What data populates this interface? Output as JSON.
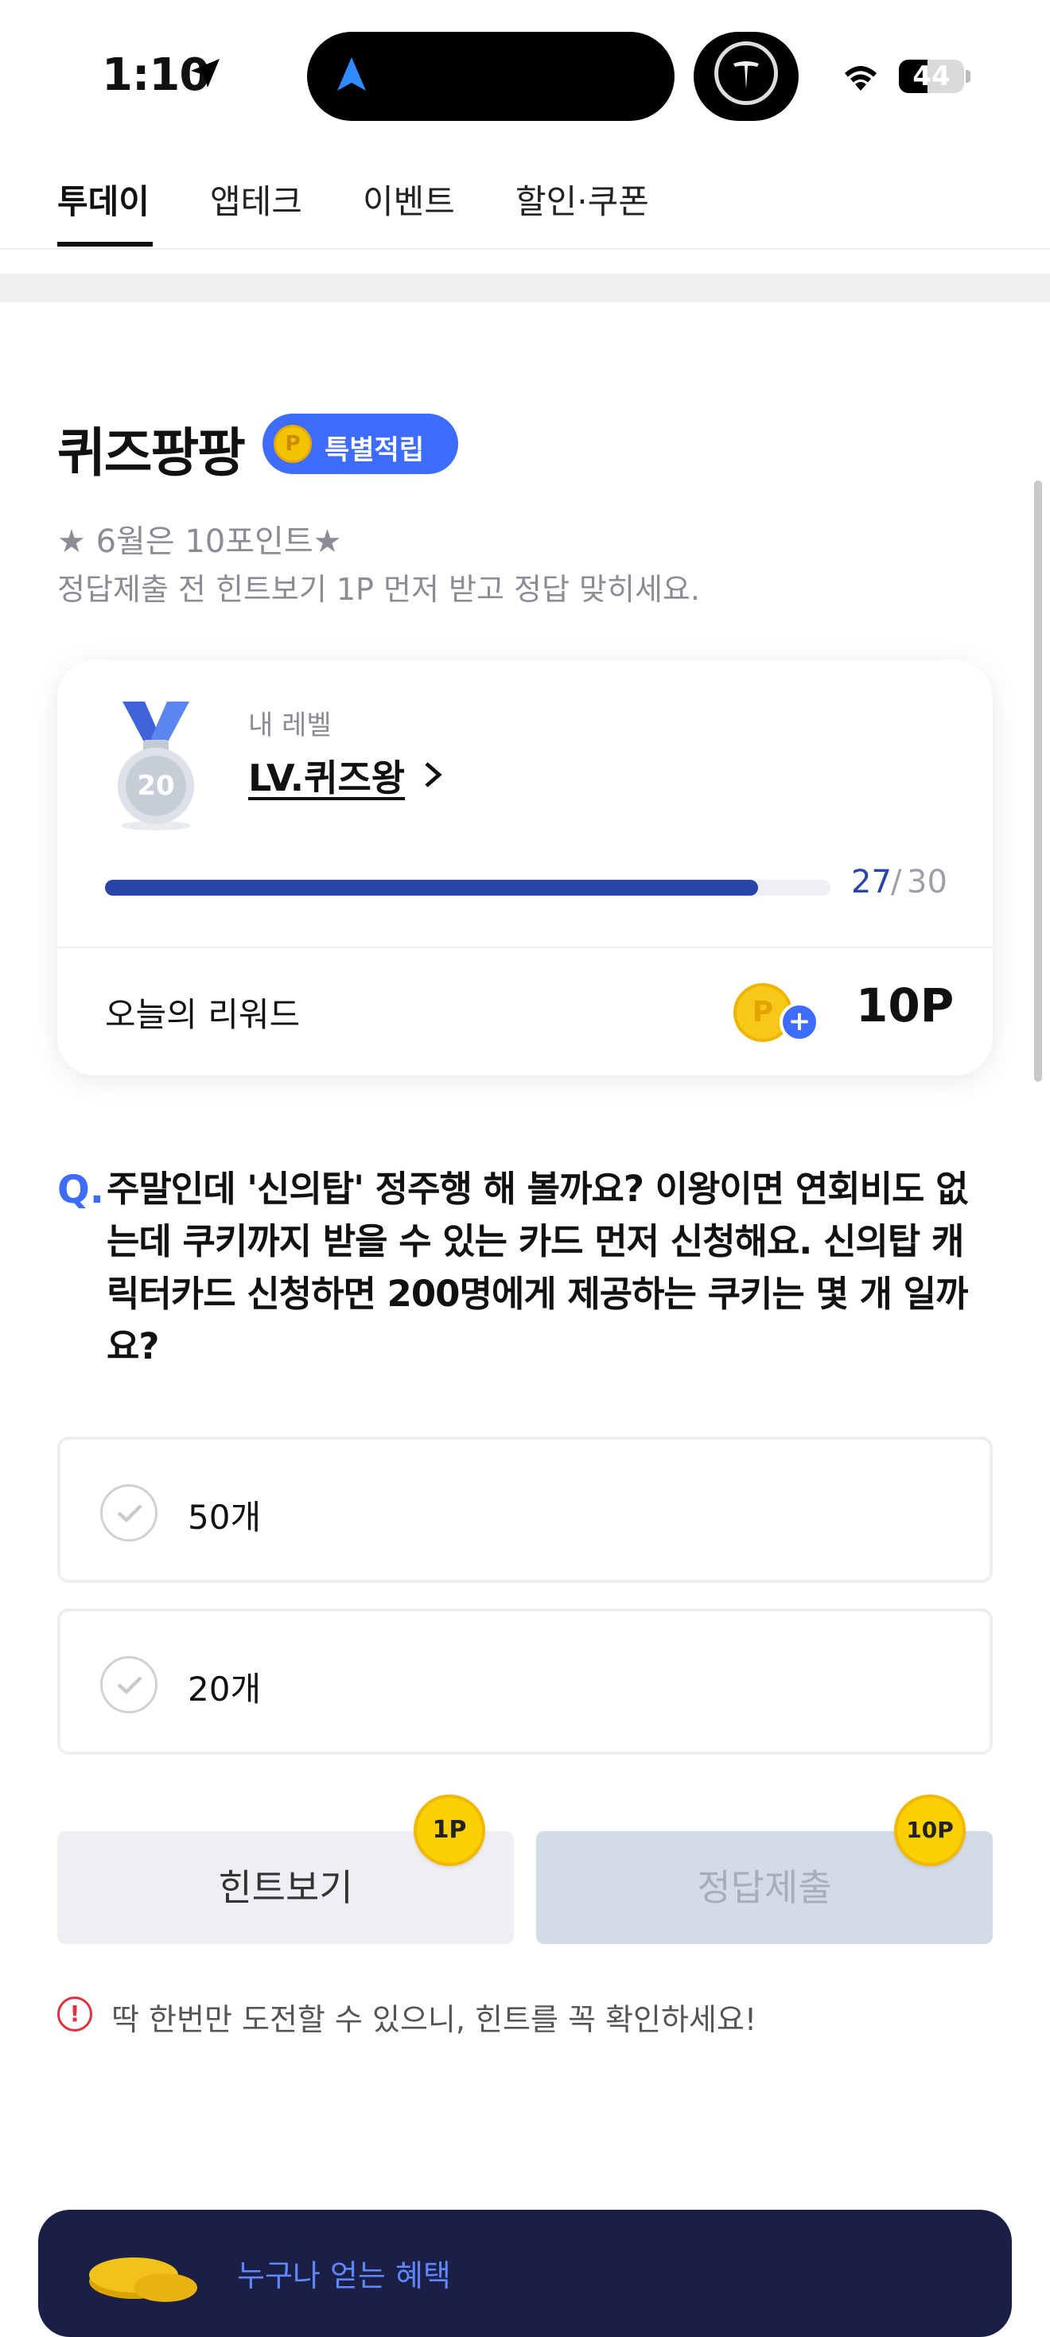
{
  "status_bar": {
    "time": "1:10",
    "battery": "44",
    "battery_level": 0.44
  },
  "tabs": [
    {
      "label": "투데이",
      "active": true
    },
    {
      "label": "앱테크",
      "active": false
    },
    {
      "label": "이벤트",
      "active": false
    },
    {
      "label": "할인·쿠폰",
      "active": false
    }
  ],
  "quiz": {
    "title": "퀴즈팡팡",
    "badge_coin": "P",
    "badge": "특별적립",
    "desc_line1": "★ 6월은 10포인트★",
    "desc_line2": "정답제출 전 힌트보기 1P 먼저 받고 정답 맞히세요."
  },
  "level_card": {
    "medal_number": "20",
    "label": "내 레벨",
    "level_name": "LV.퀴즈왕",
    "progress_current": "27",
    "progress_separator": "/",
    "progress_total": "30",
    "progress_fraction": 0.9,
    "reward_label": "오늘의 리워드",
    "reward_coin": "P",
    "reward_plus": "+",
    "reward_amount": "10P"
  },
  "question": {
    "prefix": "Q.",
    "text": "주말인데 '신의탑' 정주행 해 볼까요? 이왕이면 연회비도 없는데 쿠키까지 받을 수 있는 카드 먼저 신청해요. 신의탑 캐릭터카드 신청하면 200명에게 제공하는 쿠키는 몇 개 일까요?"
  },
  "options": [
    {
      "label": "50개"
    },
    {
      "label": "20개"
    }
  ],
  "buttons": {
    "hint_label": "힌트보기",
    "hint_points": "1P",
    "submit_label": "정답제출",
    "submit_points": "10P"
  },
  "warning": {
    "icon": "!",
    "text": "딱 한번만 도전할 수 있으니, 힌트를 꼭 확인하세요!"
  },
  "banner": {
    "text": "누구나 얻는 혜택"
  },
  "colors": {
    "accent": "#3d6cff",
    "progress": "#2a45a8",
    "banner_bg": "#1b1f45",
    "warning": "#e0303e"
  }
}
